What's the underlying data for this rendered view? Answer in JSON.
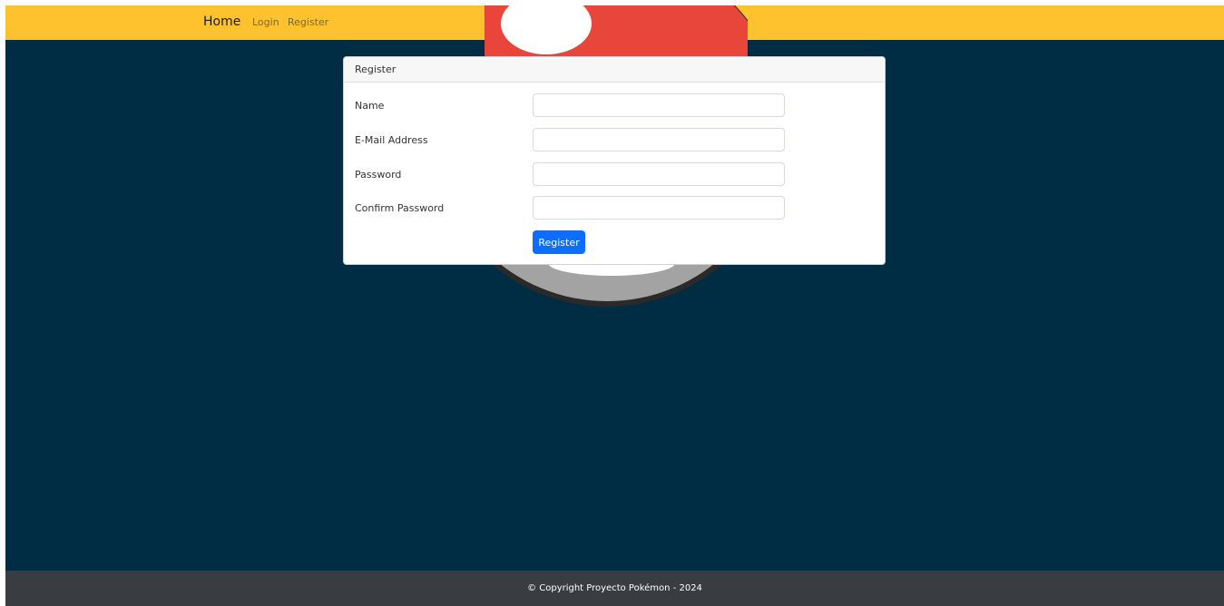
{
  "nav": {
    "brand": "Home",
    "links": [
      {
        "label": "Login"
      },
      {
        "label": "Register"
      }
    ]
  },
  "card": {
    "title": "Register",
    "fields": [
      {
        "label": "Name",
        "value": ""
      },
      {
        "label": "E-Mail Address",
        "value": ""
      },
      {
        "label": "Password",
        "value": ""
      },
      {
        "label": "Confirm Password",
        "value": ""
      }
    ],
    "submit_label": "Register"
  },
  "footer": {
    "text": "© Copyright Proyecto Pokémon - 2024"
  },
  "colors": {
    "navbar": "#ffc22f",
    "background": "#002d44",
    "footer": "#393c41",
    "primary_button": "#0d6efd",
    "pokeball_red": "#e8463a",
    "pokeball_gray": "#a3a3a3"
  }
}
